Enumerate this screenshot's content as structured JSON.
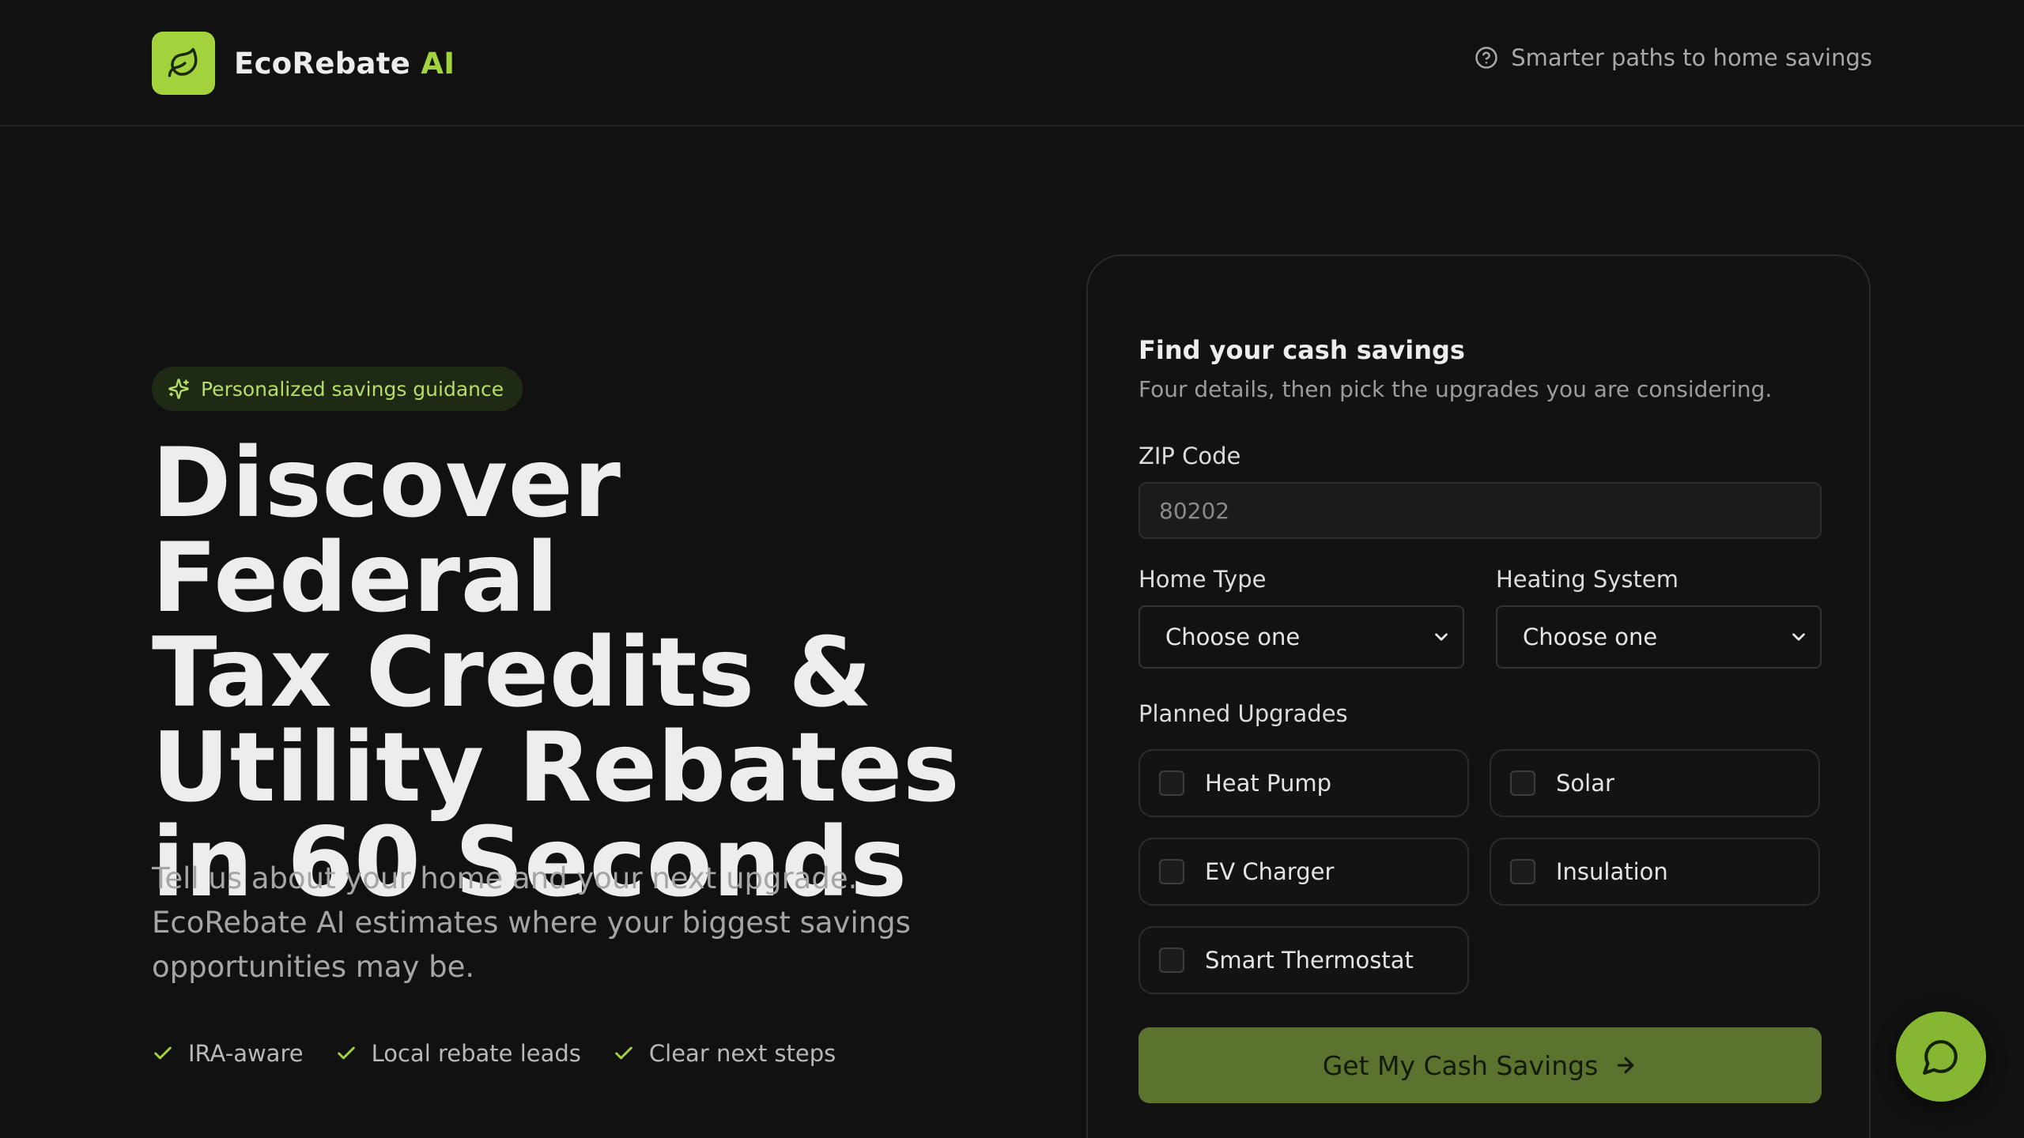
{
  "header": {
    "brand_name": "EcoRebate",
    "brand_suffix": "AI",
    "tagline": "Smarter paths to home savings",
    "logo_icon": "leaf-icon",
    "help_icon": "question-circle-icon"
  },
  "hero": {
    "pill": "Personalized savings guidance",
    "title_lines": [
      "Discover Federal",
      "Tax Credits &",
      "Utility Rebates",
      "in 60 Seconds"
    ],
    "subtitle": "Tell us about your home and your next upgrade. EcoRebate AI estimates where your biggest savings opportunities may be.",
    "features": [
      "IRA-aware",
      "Local rebate leads",
      "Clear next steps"
    ]
  },
  "form": {
    "title": "Find your cash savings",
    "subtitle": "Four details, then pick the upgrades you are considering.",
    "zip": {
      "label": "ZIP Code",
      "placeholder": "80202",
      "value": ""
    },
    "home_type": {
      "label": "Home Type",
      "selected": "Choose one"
    },
    "heating": {
      "label": "Heating System",
      "selected": "Choose one"
    },
    "upgrades": {
      "label": "Planned Upgrades",
      "options": [
        {
          "label": "Heat Pump",
          "checked": false
        },
        {
          "label": "Solar",
          "checked": false
        },
        {
          "label": "EV Charger",
          "checked": false
        },
        {
          "label": "Insulation",
          "checked": false
        },
        {
          "label": "Smart Thermostat",
          "checked": false
        }
      ]
    },
    "submit": "Get My Cash Savings"
  },
  "colors": {
    "background": "#111111",
    "accent": "#a3d33c",
    "cta": "#5c7330",
    "chat": "#86b732"
  },
  "chat": {
    "icon": "chat-bubble-icon"
  }
}
